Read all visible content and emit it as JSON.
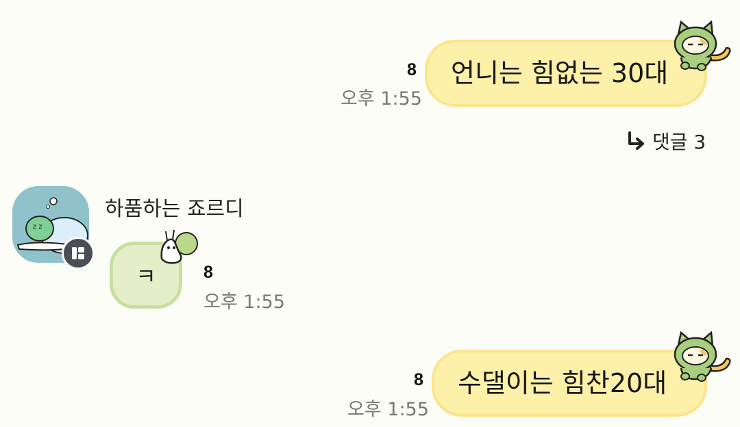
{
  "messages": [
    {
      "id": "m1",
      "direction": "outgoing",
      "text": "언니는 힘없는 30대",
      "unread_count": "8",
      "time": "오후 1:55",
      "decoration": "cat-sticker-icon"
    },
    {
      "id": "m2",
      "direction": "incoming",
      "sender": "하품하는 죠르디",
      "text": "ㅋ",
      "unread_count": "8",
      "time": "오후 1:55",
      "decoration": "snail-sticker-icon"
    },
    {
      "id": "m3",
      "direction": "outgoing",
      "text": "수댈이는 힘찬20대",
      "unread_count": "8",
      "time": "오후 1:55",
      "decoration": "cat-sticker-icon"
    }
  ],
  "reply_thread": {
    "label": "댓글 3",
    "icon": "reply-arrow-icon"
  },
  "colors": {
    "background": "#fdfdf8",
    "outgoing_bubble": "#fdf0a8",
    "outgoing_border": "#fbe58c",
    "incoming_bubble": "#e4eec8",
    "incoming_border": "#c6e0a2",
    "timestamp": "#777777"
  }
}
